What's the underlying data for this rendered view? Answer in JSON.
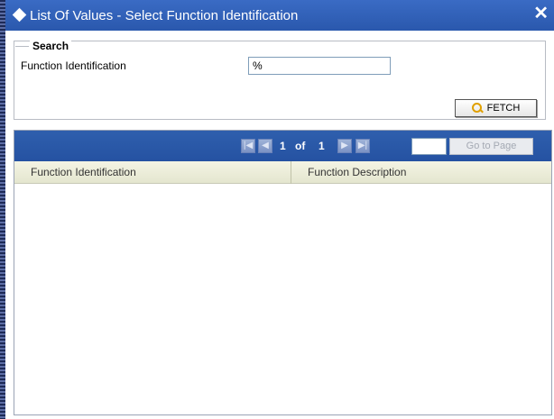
{
  "window": {
    "title": "List Of Values - Select Function Identification",
    "close_label": "✕"
  },
  "search": {
    "legend": "Search",
    "field_label": "Function Identification",
    "field_value": "%",
    "fetch_label": "FETCH"
  },
  "pager": {
    "current_page": "1",
    "of_label": "of",
    "total_pages": "1",
    "goto_label": "Go to Page",
    "goto_value": ""
  },
  "table": {
    "columns": [
      "Function Identification",
      "Function Description"
    ],
    "rows": []
  },
  "colors": {
    "titlebar": "#2a58ad",
    "pager_bar": "#2552a2",
    "header_bg": "#e4e6cf"
  },
  "icons": {
    "title": "diamond-icon",
    "fetch": "magnifier-icon",
    "first": "first-page-icon",
    "prev": "prev-page-icon",
    "next": "next-page-icon",
    "last": "last-page-icon"
  }
}
